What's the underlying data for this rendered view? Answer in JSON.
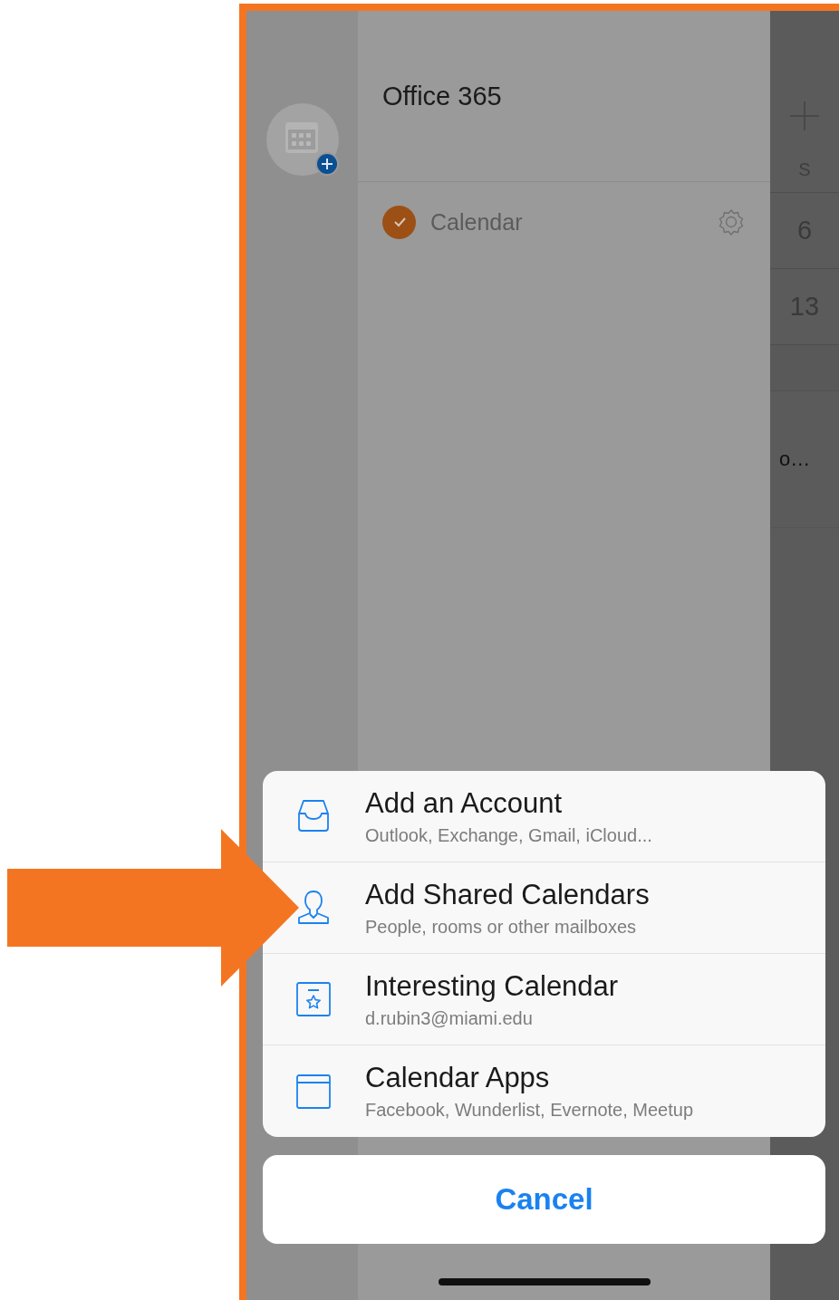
{
  "account": {
    "title": "Office 365"
  },
  "calendars": [
    {
      "name": "Calendar",
      "checked": true,
      "color": "#9c5016"
    }
  ],
  "week_strip": {
    "day_header": "S",
    "dates": [
      "6",
      "13"
    ],
    "event_text": "o…"
  },
  "actions": [
    {
      "kind": "inbox",
      "title": "Add an Account",
      "subtitle": "Outlook, Exchange, Gmail, iCloud..."
    },
    {
      "kind": "person",
      "title": "Add Shared Calendars",
      "subtitle": "People, rooms or other mailboxes"
    },
    {
      "kind": "star",
      "title": "Interesting Calendar",
      "subtitle": "d.rubin3@miami.edu"
    },
    {
      "kind": "window",
      "title": "Calendar Apps",
      "subtitle": "Facebook, Wunderlist, Evernote, Meetup"
    }
  ],
  "cancel": "Cancel"
}
